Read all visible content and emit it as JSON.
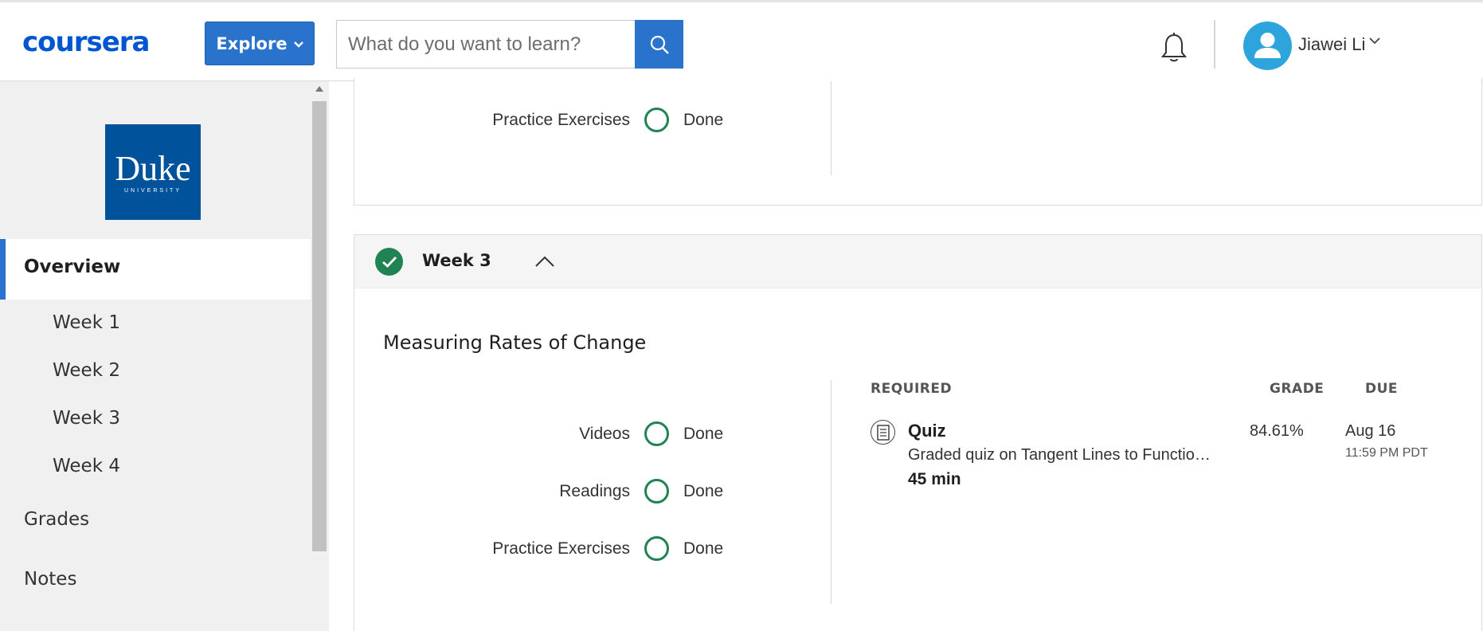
{
  "header": {
    "logo_text": "coursera",
    "explore_label": "Explore",
    "search_placeholder": "What do you want to learn?",
    "user_name": "Jiawei Li",
    "accent_color": "#2a73cc",
    "icons": [
      "search-icon",
      "bell-icon",
      "avatar-icon",
      "chevron-down-icon"
    ]
  },
  "sidebar": {
    "logo": {
      "title": "Duke",
      "subtitle": "UNIVERSITY"
    },
    "overview_label": "Overview",
    "weeks": [
      "Week 1",
      "Week 2",
      "Week 3",
      "Week 4"
    ],
    "grades_label": "Grades",
    "notes_label": "Notes"
  },
  "previous_week": {
    "progress": {
      "label": "Practice Exercises",
      "status": "Done"
    }
  },
  "week3": {
    "title": "Week 3",
    "section_title": "Measuring Rates of Change",
    "progress": [
      {
        "label": "Videos",
        "status": "Done"
      },
      {
        "label": "Readings",
        "status": "Done"
      },
      {
        "label": "Practice Exercises",
        "status": "Done"
      }
    ],
    "table": {
      "headers": {
        "required": "REQUIRED",
        "grade": "GRADE",
        "due": "DUE"
      },
      "item": {
        "type": "Quiz",
        "description": "Graded quiz on Tangent Lines to Functio…",
        "duration": "45 min",
        "grade": "84.61%",
        "due_date": "Aug 16",
        "due_time": "11:59 PM PDT"
      }
    },
    "status_color": "#1f8354"
  }
}
